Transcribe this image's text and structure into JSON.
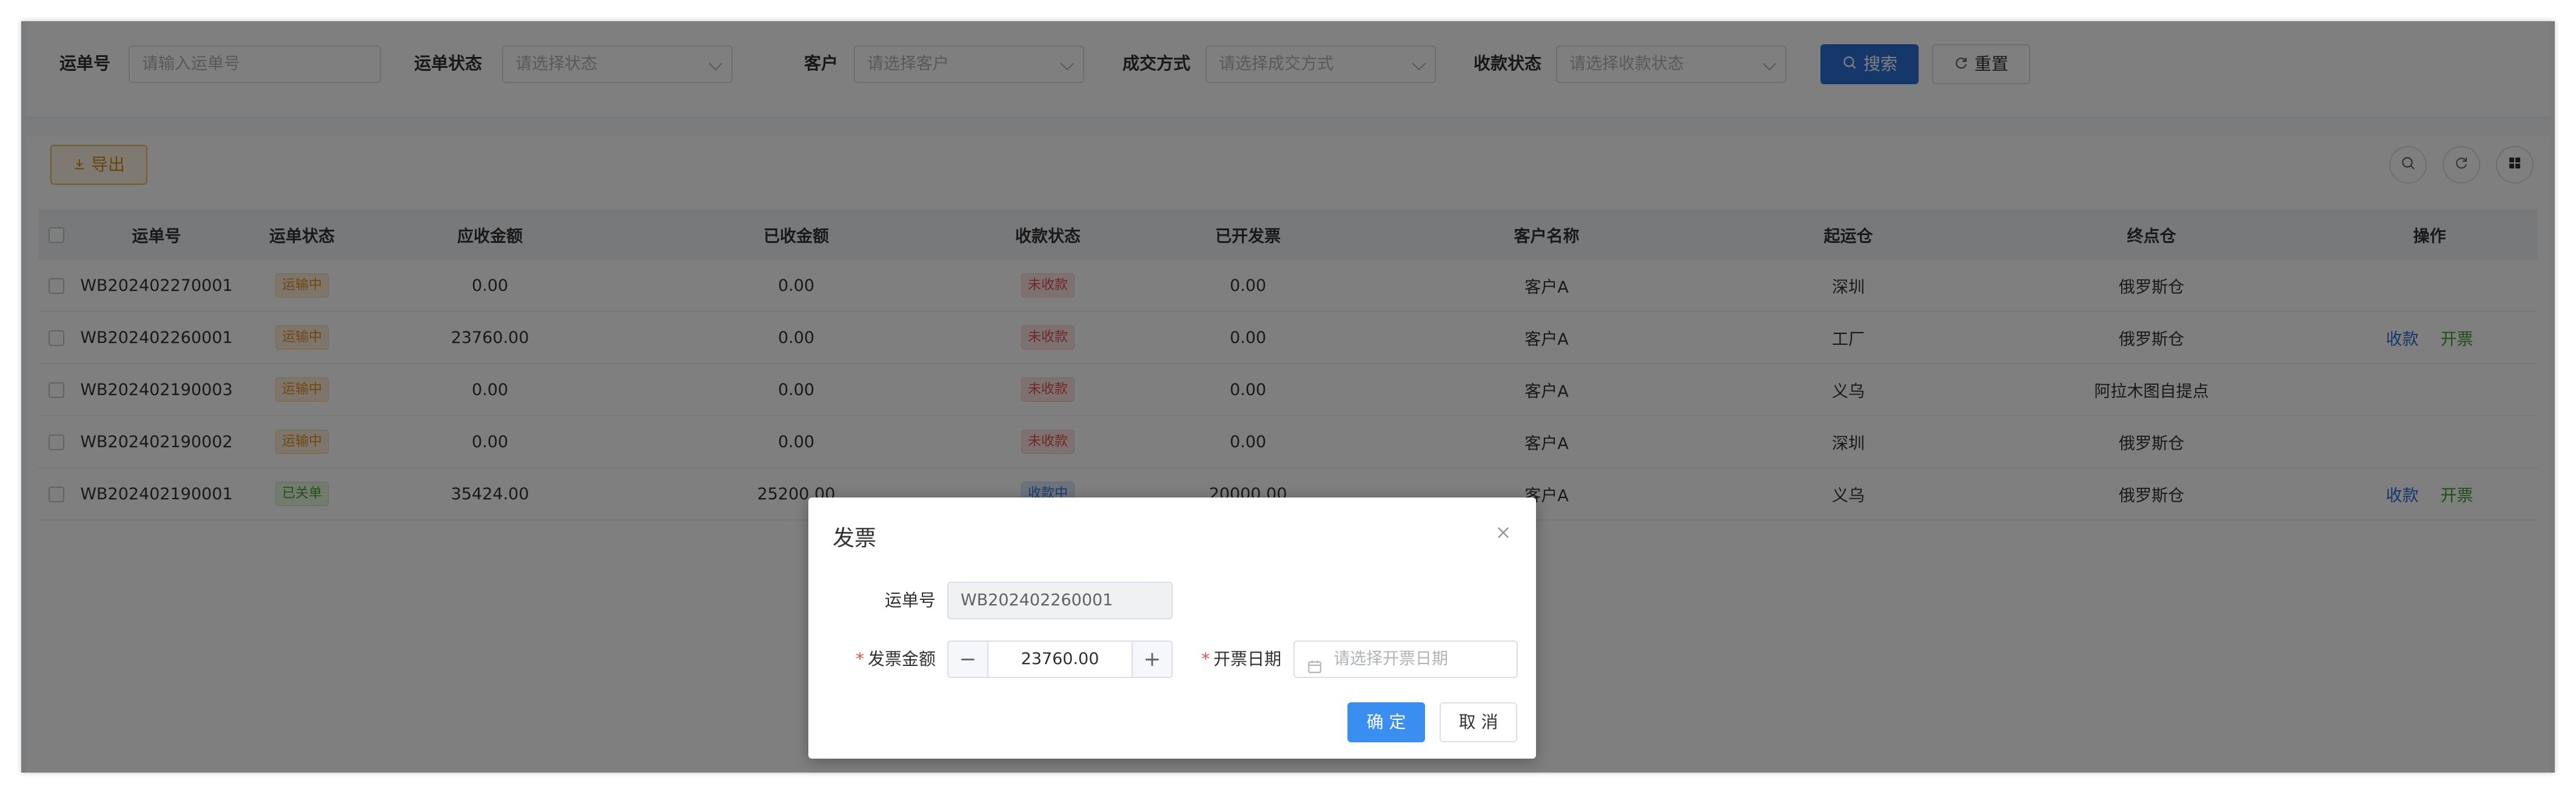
{
  "search": {
    "waybill_label": "运单号",
    "waybill_placeholder": "请输入运单号",
    "status_label": "运单状态",
    "status_placeholder": "请选择状态",
    "customer_label": "客户",
    "customer_placeholder": "请选择客户",
    "deal_label": "成交方式",
    "deal_placeholder": "请选择成交方式",
    "payment_label": "收款状态",
    "payment_placeholder": "请选择收款状态",
    "search_button": "搜索",
    "reset_button": "重置"
  },
  "toolbar": {
    "export_button": "导出"
  },
  "table": {
    "headers": [
      "运单号",
      "运单状态",
      "应收金额",
      "已收金额",
      "收款状态",
      "已开发票",
      "客户名称",
      "起运仓",
      "终点仓",
      "操作"
    ],
    "rows": [
      {
        "waybill": "WB202402270001",
        "status": "运输中",
        "receivable": "0.00",
        "received": "0.00",
        "payment": "未收款",
        "invoiced": "0.00",
        "customer": "客户A",
        "origin": "深圳",
        "dest": "俄罗斯仓",
        "op1": "",
        "op2": ""
      },
      {
        "waybill": "WB202402260001",
        "status": "运输中",
        "receivable": "23760.00",
        "received": "0.00",
        "payment": "未收款",
        "invoiced": "0.00",
        "customer": "客户A",
        "origin": "工厂",
        "dest": "俄罗斯仓",
        "op1": "收款",
        "op2": "开票"
      },
      {
        "waybill": "WB202402190003",
        "status": "运输中",
        "receivable": "0.00",
        "received": "0.00",
        "payment": "未收款",
        "invoiced": "0.00",
        "customer": "客户A",
        "origin": "义乌",
        "dest": "阿拉木图自提点",
        "op1": "",
        "op2": ""
      },
      {
        "waybill": "WB202402190002",
        "status": "运输中",
        "receivable": "0.00",
        "received": "0.00",
        "payment": "未收款",
        "invoiced": "0.00",
        "customer": "客户A",
        "origin": "深圳",
        "dest": "俄罗斯仓",
        "op1": "",
        "op2": ""
      },
      {
        "waybill": "WB202402190001",
        "status": "已关单",
        "receivable": "35424.00",
        "received": "25200.00",
        "payment": "收款中",
        "invoiced": "20000.00",
        "customer": "客户A",
        "origin": "义乌",
        "dest": "俄罗斯仓",
        "op1": "收款",
        "op2": "开票"
      }
    ]
  },
  "dialog": {
    "title": "发票",
    "waybill_label": "运单号",
    "waybill_value": "WB202402260001",
    "amount_required": "*",
    "amount_label": "发票金额",
    "amount_value": "23760.00",
    "minus": "−",
    "plus": "+",
    "date_required": "*",
    "date_label": "开票日期",
    "date_placeholder": "请选择开票日期",
    "ok_button": "确 定",
    "cancel_button": "取 消"
  },
  "icons": {
    "search": "search-icon",
    "reset": "refresh-icon",
    "export": "download-icon",
    "close": "close-icon",
    "calendar": "calendar-icon",
    "grid": "grid-icon"
  },
  "colors": {
    "primary": "#2b6fd8",
    "confirm": "#3a8ef0",
    "success": "#38a02a",
    "warning": "#e38c2b",
    "danger": "#e0514c"
  }
}
